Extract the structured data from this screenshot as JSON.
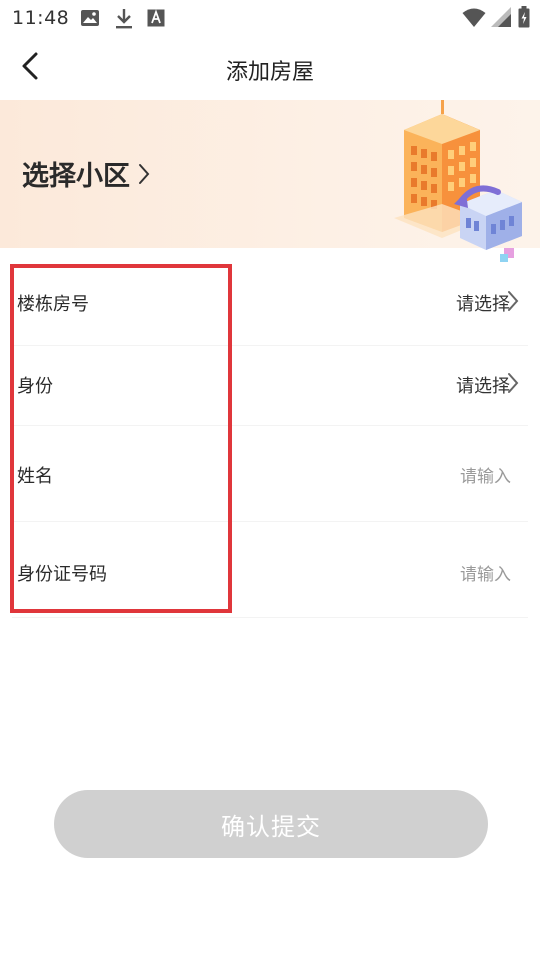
{
  "status_bar": {
    "time": "11:48",
    "left_icons": [
      "image-icon",
      "download-icon",
      "text-a-icon"
    ],
    "right_icons": [
      "wifi-icon",
      "signal-icon",
      "battery-icon"
    ]
  },
  "header": {
    "title": "添加房屋",
    "back_icon": "back-arrow-icon"
  },
  "banner": {
    "select_label": "选择小区",
    "chevron": "chevron-right-icon",
    "illustration": "building-illustration"
  },
  "form": {
    "rows": [
      {
        "label": "楼栋房号",
        "value": "请选择",
        "type": "select"
      },
      {
        "label": "身份",
        "value": "请选择",
        "type": "select"
      },
      {
        "label": "姓名",
        "value": "请输入",
        "type": "input"
      },
      {
        "label": "身份证号码",
        "value": "请输入",
        "type": "input"
      }
    ]
  },
  "submit": {
    "label": "确认提交"
  },
  "colors": {
    "highlight_border": "#e0363b",
    "submit_disabled": "#d0d0d0",
    "banner_bg": "#fce9da"
  }
}
